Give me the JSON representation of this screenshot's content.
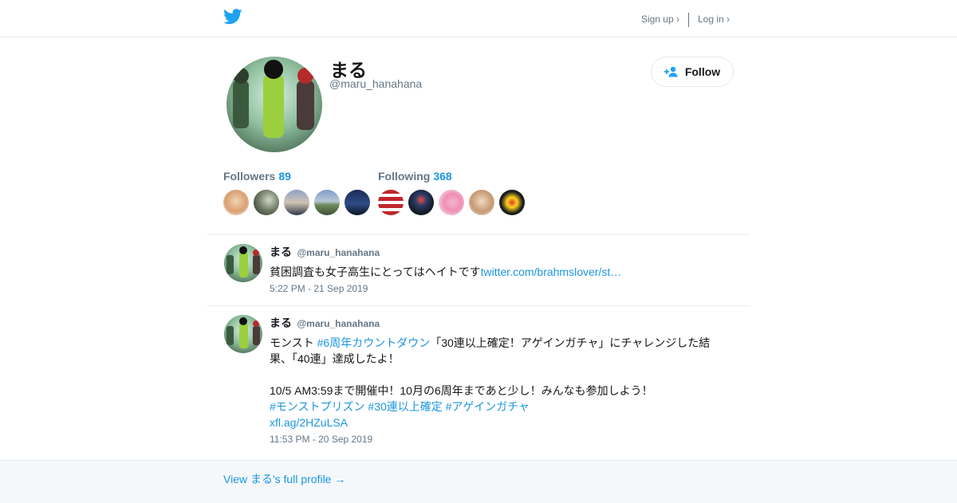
{
  "topnav": {
    "signup_label": "Sign up ›",
    "login_label": "Log in ›"
  },
  "profile": {
    "display_name": "まる",
    "handle": "@maru_hanahana",
    "follow_label": "Follow"
  },
  "followers": {
    "label": "Followers",
    "count": "89",
    "avatars": [
      {
        "bg": "#e8b98d"
      },
      {
        "bg": "#6d7a63"
      },
      {
        "bg": "#3f4f6e"
      },
      {
        "bg": "#6c8a5a"
      },
      {
        "bg": "#22335a"
      }
    ]
  },
  "following": {
    "label": "Following",
    "count": "368",
    "avatars": [
      {
        "bg": "#c0262c"
      },
      {
        "bg": "#1b2230"
      },
      {
        "bg": "#ef8fb3"
      },
      {
        "bg": "#d8b89a"
      },
      {
        "bg": "#1c1c1c"
      }
    ]
  },
  "tweets": [
    {
      "name": "まる",
      "handle": "@maru_hanahana",
      "text": "貧困調査も女子高生にとってはヘイトです",
      "link": "twitter.com/brahmslover/st…",
      "time": "5:22 PM - 21 Sep 2019"
    },
    {
      "name": "まる",
      "handle": "@maru_hanahana",
      "text_a": "モンスト ",
      "hashtag_1": "#6周年カウントダウン",
      "text_b": "「30連以上確定！アゲインガチャ」にチャレンジした結果、「40連」達成したよ！\n\n10/5 AM3:59まで開催中！10月の6周年まであと少し！みんなも参加しよう！\n",
      "hashtag_2": "#モンストプリズン",
      "hashtag_3": "#30連以上確定",
      "hashtag_4": "#アゲインガチャ",
      "link": "xfl.ag/2HZuLSA",
      "time": "11:53 PM - 20 Sep 2019"
    }
  ],
  "footer": {
    "link_label": "View まる's full profile →"
  },
  "colors": {
    "accent": "#1b95e0",
    "muted": "#657786",
    "bird": "#1da1f2"
  }
}
